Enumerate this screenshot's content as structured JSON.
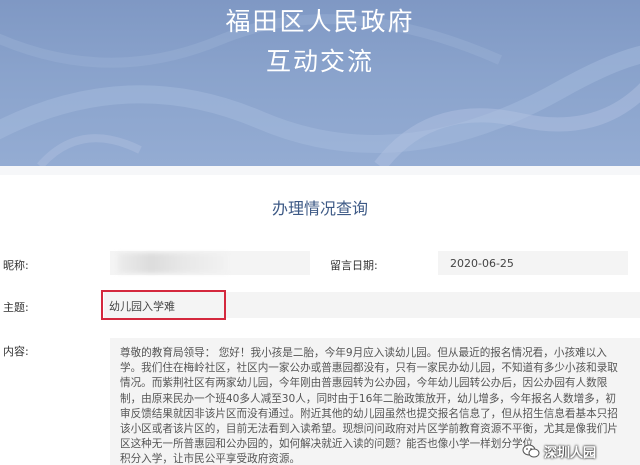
{
  "banner": {
    "title_line1": "福田区人民政府",
    "title_line2": "互动交流"
  },
  "section_title": "办理情况查询",
  "form": {
    "nickname_label": "昵称:",
    "nickname_value": "",
    "date_label": "留言日期:",
    "date_value": "2020-06-25",
    "subject_label": "主题:",
    "subject_value": "幼儿园入学难",
    "content_label": "内容:",
    "content_lines": [
      "尊敬的教育局领导：  您好！我小孩是二胎，今年9月应入读幼儿园。但从最近的报名情况看，小孩难以入",
      "学。我们住在梅岭社区，社区内一家公办或普惠园都没有，只有一家民办幼儿园，不知道有多少小孩和录取",
      "情况。而紫荆社区有两家幼儿园，今年刚由普惠园转为公办园，今年幼儿园转公办后，因公办园有人数限",
      "制，由原来民办一个班40多人减至30人，同时由于16年二胎政策放开，幼儿增多，今年报名人数增多，初",
      "审反馈结果就因非该片区而没有通过。附近其他的幼儿园虽然也提交报名信息了，但从招生信息看基本只招",
      "该小区或者该片区的，目前无法看到入读希望。现想问问政府对片区学前教育资源不平衡，尤其是像我们片",
      "区这种无一所普惠园和公办园的，如何解决就近入读的问题？能否也像小学一样划分学位",
      "积分入学，让市民公平享受政府资源。"
    ]
  },
  "watermark": {
    "text": "深圳人园",
    "icon": "wechat-icon"
  },
  "colors": {
    "banner": "#8aa3cc",
    "section_title": "#3e5a86",
    "highlight": "#d4283d",
    "field_bg": "#f4f4f4"
  }
}
